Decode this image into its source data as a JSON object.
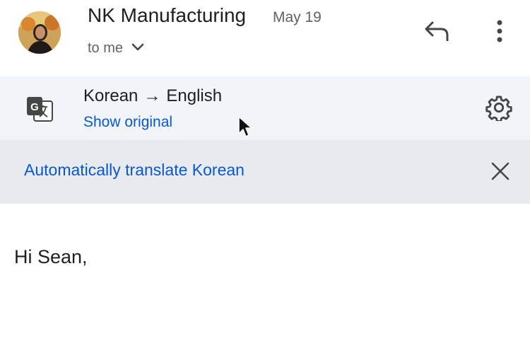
{
  "header": {
    "sender": "NK Manufacturing",
    "date": "May 19",
    "recipient": "to me"
  },
  "translation": {
    "source_language": "Korean",
    "arrow": "→",
    "target_language": "English",
    "show_original_label": "Show original",
    "auto_translate_label": "Automatically translate Korean"
  },
  "message": {
    "greeting": "Hi Sean,"
  },
  "icons": {
    "avatar": "avatar-photo",
    "recipient_expand": "chevron-down-icon",
    "reply": "reply-icon",
    "more": "more-vert-icon",
    "translate": "translate-icon",
    "settings": "gear-icon",
    "close": "close-icon",
    "cursor": "mouse-pointer-icon"
  },
  "colors": {
    "link_blue": "#0b57d0",
    "translate_bar_bg": "#f1f4f8",
    "auto_bar_bg": "#e7ebf0",
    "text_primary": "#1f1f1f",
    "text_secondary": "#5f6368"
  }
}
